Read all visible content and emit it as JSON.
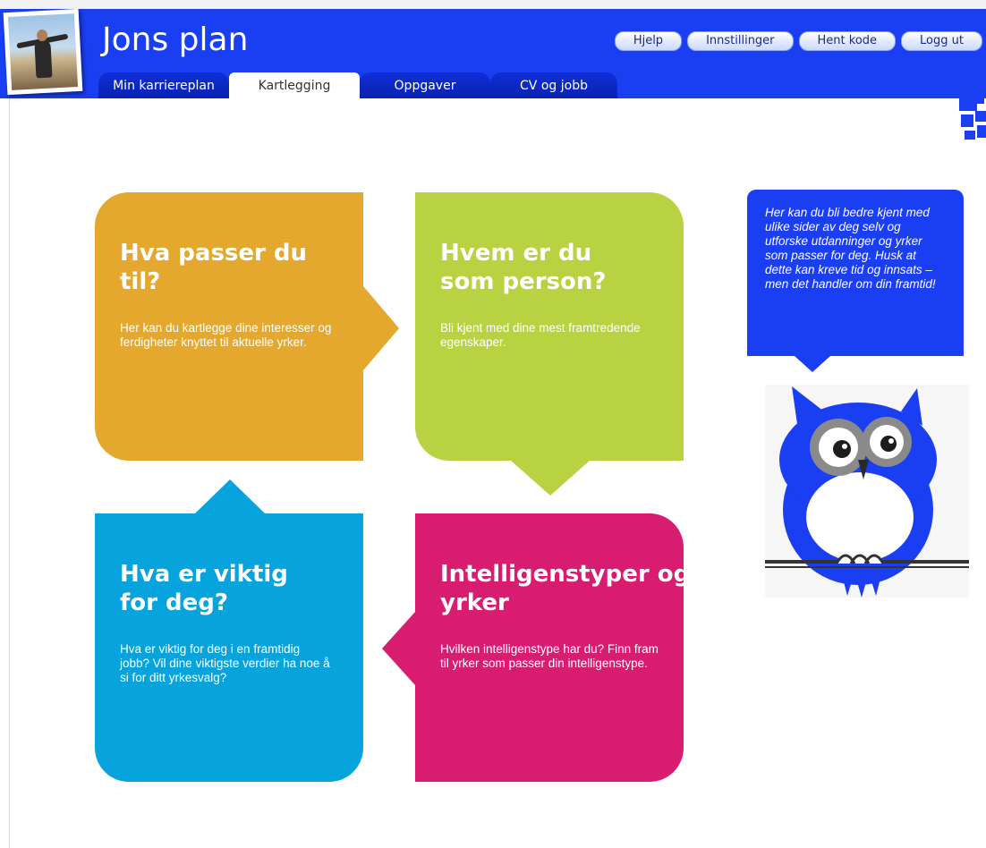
{
  "header": {
    "title": "Jons plan",
    "buttons": {
      "help": "Hjelp",
      "settings": "Innstillinger",
      "get_code": "Hent kode",
      "logout": "Logg ut"
    },
    "tabs": [
      "Min karriereplan",
      "Kartlegging",
      "Oppgaver",
      "CV og jobb"
    ],
    "active_tab": "Kartlegging"
  },
  "cards": [
    {
      "title": "Hva passer du til?",
      "text": "Her kan du kartlegge dine interesser og ferdigheter knyttet til aktuelle yrker.",
      "color": "#e3a82d"
    },
    {
      "title": "Hvem er du som person?",
      "text": "Bli kjent med dine mest framtredende egenskaper.",
      "color": "#b9d241"
    },
    {
      "title": "Hva er viktig for deg?",
      "text": "Hva er viktig for deg i en framtidig jobb? Vil dine viktigste verdier ha noe å si for ditt yrkesvalg?",
      "color": "#06a3dc"
    },
    {
      "title": "Intelligenstyper og yrker",
      "text": "Hvilken intelligenstype har du? Finn fram til yrker som passer din intelligenstype.",
      "color": "#d81c6f"
    }
  ],
  "info_bubble": {
    "text": "Her kan du bli bedre kjent med ulike sider av deg selv og utforske utdanninger og yrker som passer for deg. Husk at dette kan kreve tid og innsats – men det handler om din framtid!"
  },
  "colors": {
    "brand": "#1a3ef2"
  },
  "icons": [
    "profile-photo",
    "owl-mascot-icon"
  ]
}
